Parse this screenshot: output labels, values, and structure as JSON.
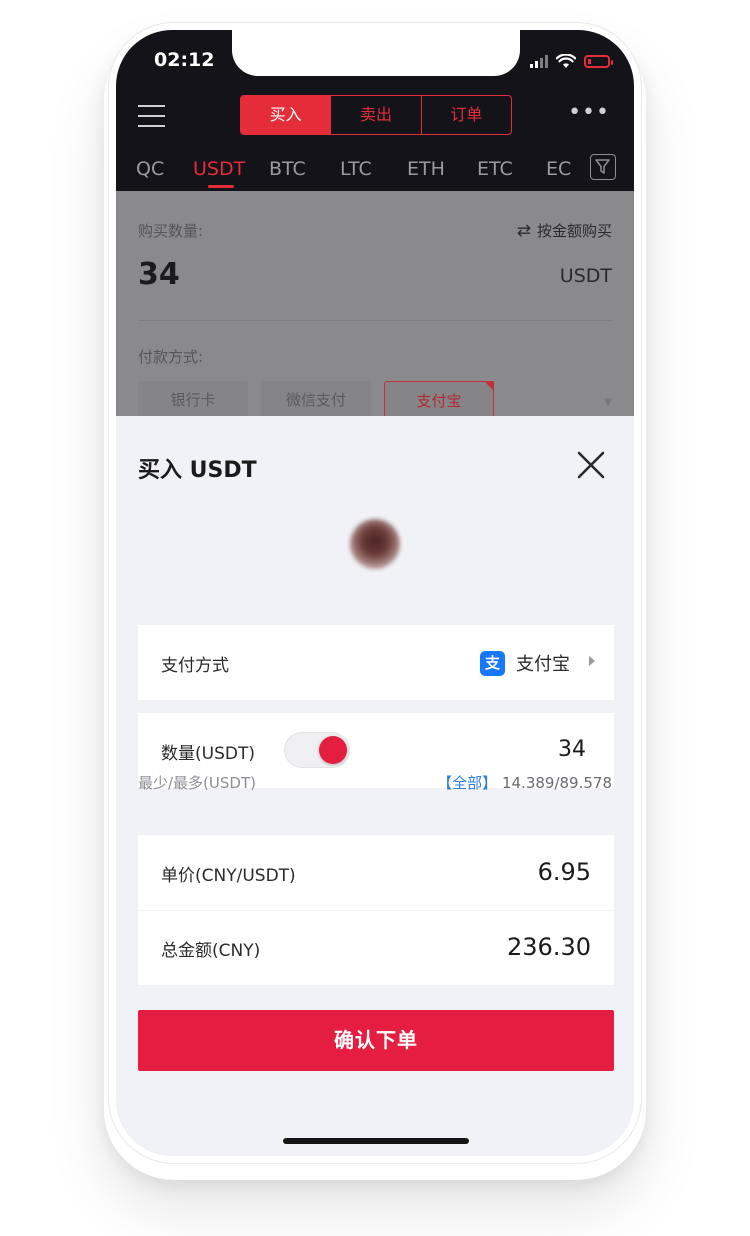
{
  "status_bar": {
    "time": "02:12"
  },
  "header": {
    "segments": [
      {
        "label": "买入",
        "active": true
      },
      {
        "label": "卖出",
        "active": false
      },
      {
        "label": "订单",
        "active": false
      }
    ],
    "more_label": "•••"
  },
  "coin_tabs": [
    {
      "label": "QC",
      "active": false
    },
    {
      "label": "USDT",
      "active": true
    },
    {
      "label": "BTC",
      "active": false
    },
    {
      "label": "LTC",
      "active": false
    },
    {
      "label": "ETH",
      "active": false
    },
    {
      "label": "ETC",
      "active": false
    },
    {
      "label": "EC",
      "active": false
    }
  ],
  "background_form": {
    "amount_label": "购买数量:",
    "switch_label": "按金额购买",
    "amount_value": "34",
    "unit": "USDT",
    "payment_label": "付款方式:",
    "payment_options": [
      "银行卡",
      "微信支付",
      "支付宝"
    ],
    "selected_option": "支付宝"
  },
  "sheet": {
    "title": "买入 USDT",
    "payment_method": {
      "label": "支付方式",
      "value": "支付宝",
      "icon": "alipay-icon",
      "icon_glyph": "支"
    },
    "quantity": {
      "label": "数量(USDT)",
      "toggle_on": true,
      "value": "34"
    },
    "range": {
      "label": "最少/最多(USDT)",
      "all_link": "【全部】",
      "values": "14.389/89.578"
    },
    "unit_price": {
      "label": "单价(CNY/USDT)",
      "value": "6.95"
    },
    "total": {
      "label": "总金额(CNY)",
      "value": "236.30"
    },
    "confirm_label": "确认下单"
  },
  "colors": {
    "accent": "#e51e41",
    "header_bg": "#14131a",
    "link": "#2f7ee0",
    "alipay": "#1677ff"
  }
}
